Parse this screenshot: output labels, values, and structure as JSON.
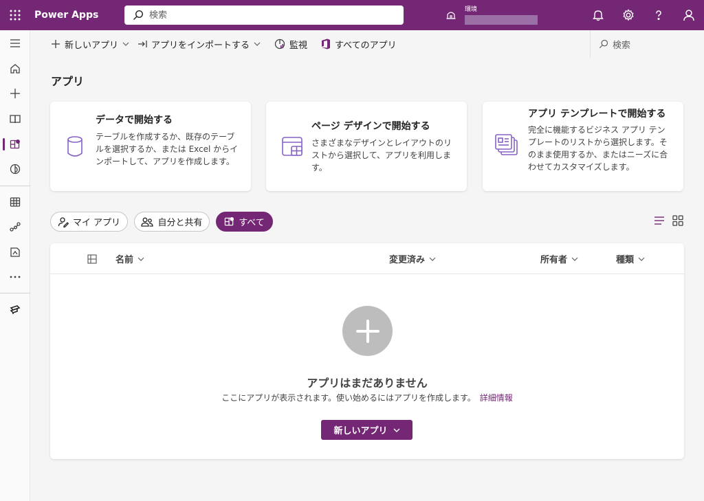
{
  "header": {
    "app_name": "Power Apps",
    "search_placeholder": "検索",
    "environment_label": "環境"
  },
  "commandbar": {
    "new_app": "新しいアプリ",
    "import_app": "アプリをインポートする",
    "monitor": "監視",
    "all_apps": "すべてのアプリ",
    "search": "検索"
  },
  "page": {
    "title": "アプリ"
  },
  "cards": [
    {
      "title": "データで開始する",
      "desc": "テーブルを作成するか、既存のテーブルを選択するか、または Excel からインポートして、アプリを作成します。"
    },
    {
      "title": "ページ デザインで開始する",
      "desc": "さまざまなデザインとレイアウトのリストから選択して、アプリを利用します。"
    },
    {
      "title": "アプリ テンプレートで開始する",
      "desc": "完全に機能するビジネス アプリ テンプレートのリストから選択します。そのまま使用するか、またはニーズに合わせてカスタマイズします。"
    }
  ],
  "filters": {
    "my_apps": "マイ アプリ",
    "shared": "自分と共有",
    "all": "すべて"
  },
  "table": {
    "columns": [
      "名前",
      "変更済み",
      "所有者",
      "種類"
    ]
  },
  "empty": {
    "title": "アプリはまだありません",
    "desc": "ここにアプリが表示されます。使い始めるにはアプリを作成します。",
    "link": "詳細情報",
    "button": "新しいアプリ"
  },
  "colors": {
    "brand": "#742774",
    "background": "#f5f5f5"
  }
}
